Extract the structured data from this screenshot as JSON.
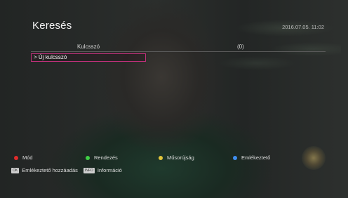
{
  "screen": {
    "title": "Keresés",
    "datetime": "2016.07.05. 11:02"
  },
  "list": {
    "columns": {
      "keyword": "Kulcsszó",
      "count": "(0)"
    },
    "items": [
      {
        "label": "> Új kulcsszó",
        "selected": true
      }
    ]
  },
  "footer": {
    "buttons": [
      {
        "color": "red",
        "label": "Mód"
      },
      {
        "color": "green",
        "label": "Rendezés"
      },
      {
        "color": "yellow",
        "label": "Műsorújság"
      },
      {
        "color": "blue",
        "label": "Emlékeztető"
      }
    ],
    "keys": [
      {
        "key": "OK",
        "label": "Emlékeztető hozzáadás"
      },
      {
        "key": "INFO",
        "label": "Információ"
      }
    ]
  },
  "colors": {
    "selection_border": "#c0307a",
    "red": "#e02b2b",
    "green": "#3fcf45",
    "yellow": "#e3c63b",
    "blue": "#3f8ef0"
  }
}
